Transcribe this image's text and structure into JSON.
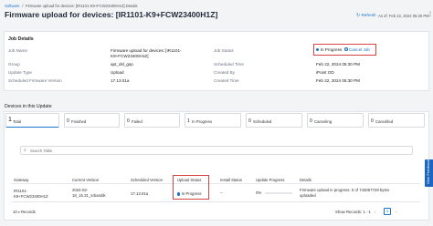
{
  "breadcrumb": {
    "root": "Software",
    "separator": "/",
    "current": "Firmware upload for devices: [IR1101-K9+FCW23400H1Z] Details"
  },
  "header": {
    "title": "Firmware upload for devices: [IR1101-K9+FCW23400H1Z]",
    "refresh_label": "Refresh",
    "as_of": "As of: Feb 22, 2024 05:30 PM"
  },
  "job_details": {
    "heading": "Job Details",
    "job_name_label": "Job Name",
    "job_name_value": "Firmware upload for devices: [IR1101-K9+FCW23400H1Z]",
    "job_status_label": "Job Status",
    "job_status_value": "In Progress",
    "cancel_job_label": "Cancel Job",
    "group_label": "Group",
    "group_value": "apt_dsl_gsp",
    "scheduled_time_label": "Scheduled Time",
    "scheduled_time_value": "Feb 22, 2024 05:30 PM",
    "update_type_label": "Update Type",
    "update_type_value": "Upload",
    "created_by_label": "Created By",
    "created_by_value": "iPoint OD",
    "scheduled_fw_label": "Scheduled Firmware Version",
    "scheduled_fw_value": "17.13.01a",
    "created_time_label": "Created Time",
    "created_time_value": "Feb 22, 2024 05:30 PM"
  },
  "devices": {
    "heading": "Devices in this Update",
    "stats": [
      {
        "num": "1",
        "label": "Total"
      },
      {
        "num": "0",
        "label": "Finished"
      },
      {
        "num": "0",
        "label": "Failed"
      },
      {
        "num": "1",
        "label": "In Progress"
      },
      {
        "num": "0",
        "label": "Scheduled"
      },
      {
        "num": "0",
        "label": "Canceling"
      },
      {
        "num": "0",
        "label": "Cancelled"
      }
    ],
    "search_placeholder": "Search Table",
    "columns": [
      "Gateway",
      "Current Version",
      "Scheduled Version",
      "Upload Status",
      "Install Status",
      "Update Progress",
      "Details"
    ],
    "row": {
      "gateway": "IR1101-K9+FCW23400H1Z",
      "current_version": "2024-02-18_15.31_srbandik",
      "scheduled_version": "17.13.01a",
      "upload_status": "In Progress",
      "install_status": "--",
      "update_progress": "0%",
      "update_progress_fraction": 0,
      "details": "Firmware upload in progress: 0 of 743057728 bytes uploaded"
    },
    "footer": {
      "records_label": "Records",
      "records_value": "10",
      "show_records": "Show Records: 1 - 1",
      "page": "1"
    }
  },
  "side_tab": {
    "label": "Give Feedback"
  },
  "colors": {
    "accent": "#1a73c8",
    "highlight": "#d64545",
    "side_tab": "#1a66c0"
  }
}
